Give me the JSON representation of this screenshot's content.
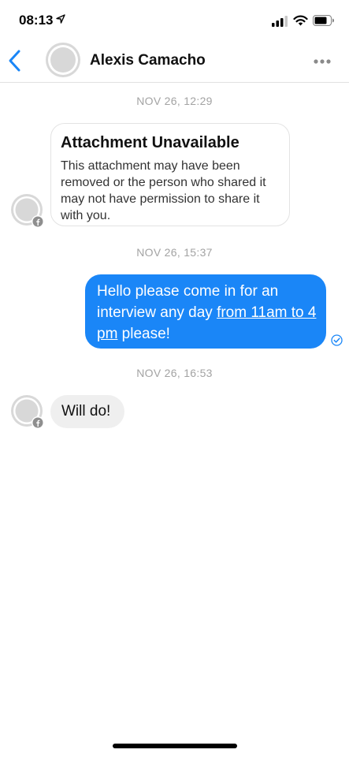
{
  "status_bar": {
    "time": "08:13"
  },
  "header": {
    "contact_name": "Alexis Camacho"
  },
  "messages": {
    "ts1": "NOV 26, 12:29",
    "attachment_title": "Attachment Unavailable",
    "attachment_body": "This attachment may have been removed or the person who shared it may not have permission to share it with you.",
    "ts2": "NOV 26, 15:37",
    "outgoing_text_1": "Hello please come in for an interview any day ",
    "outgoing_link": "from 11am to 4 pm",
    "outgoing_text_2": " please!",
    "ts3": "NOV 26, 16:53",
    "incoming_text": "Will do!"
  },
  "colors": {
    "accent": "#1a86f7",
    "timestamp": "#a3a3a3",
    "incoming_bubble": "#efefef"
  },
  "icons": [
    "location-arrow-icon",
    "signal-icon",
    "wifi-icon",
    "battery-icon",
    "back-chevron-icon",
    "avatar-placeholder-icon",
    "more-options-icon",
    "facebook-badge-icon",
    "seen-check-icon"
  ]
}
